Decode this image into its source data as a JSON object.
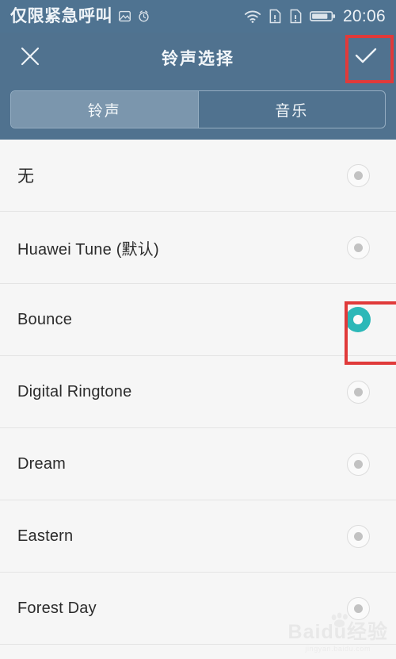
{
  "statusbar": {
    "carrier_text": "仅限紧急呼叫",
    "icons": [
      "no-service-icon",
      "alarm-icon",
      "wifi-icon",
      "sim1-icon",
      "sim2-icon",
      "battery-icon"
    ],
    "time": "20:06"
  },
  "titlebar": {
    "close_label": "✕",
    "close_icon": "close-icon",
    "title": "铃声选择",
    "confirm_label": "✓",
    "confirm_icon": "check-icon"
  },
  "tabs": [
    {
      "label": "铃声",
      "active": true
    },
    {
      "label": "音乐",
      "active": false
    }
  ],
  "ringtones": [
    {
      "label": "无",
      "selected": false,
      "cjk": true
    },
    {
      "label": "Huawei Tune (默认)",
      "selected": false,
      "cjk": false
    },
    {
      "label": "Bounce",
      "selected": true,
      "cjk": false
    },
    {
      "label": "Digital Ringtone",
      "selected": false,
      "cjk": false
    },
    {
      "label": "Dream",
      "selected": false,
      "cjk": false
    },
    {
      "label": "Eastern",
      "selected": false,
      "cjk": false
    },
    {
      "label": "Forest Day",
      "selected": false,
      "cjk": false
    }
  ],
  "watermark": {
    "main": "Baidu经验",
    "sub": "jingyan.baidu.com"
  },
  "colors": {
    "header_blue": "#50728f",
    "statusbar_blue": "#4f7391",
    "tab_active": "#7b96ad",
    "accent_teal": "#2cb8b8",
    "highlight_red": "#e03a3a",
    "list_bg": "#f6f6f6",
    "text_primary": "#2b2b2b"
  },
  "annotations": [
    {
      "name": "confirm-highlight",
      "target": "confirm-button"
    },
    {
      "name": "bounce-radio-highlight",
      "target": "ringtone-radio-bounce"
    }
  ]
}
